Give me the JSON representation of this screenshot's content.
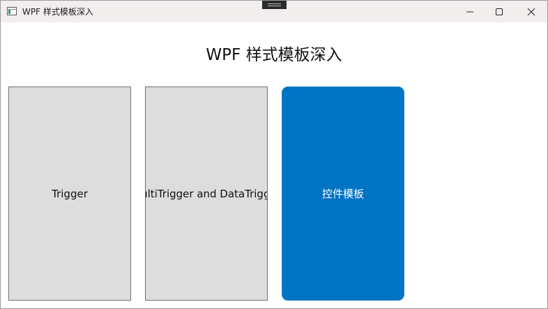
{
  "window": {
    "title": "WPF 样式模板深入"
  },
  "main": {
    "heading": "WPF 样式模板深入",
    "buttons": [
      {
        "label": "Trigger"
      },
      {
        "label": "MultiTrigger and DataTrigger"
      },
      {
        "label": "控件模板"
      }
    ]
  },
  "colors": {
    "titlebar": "#f3eeee",
    "tile_gray": "#dddddd",
    "tile_blue": "#0074c4"
  }
}
